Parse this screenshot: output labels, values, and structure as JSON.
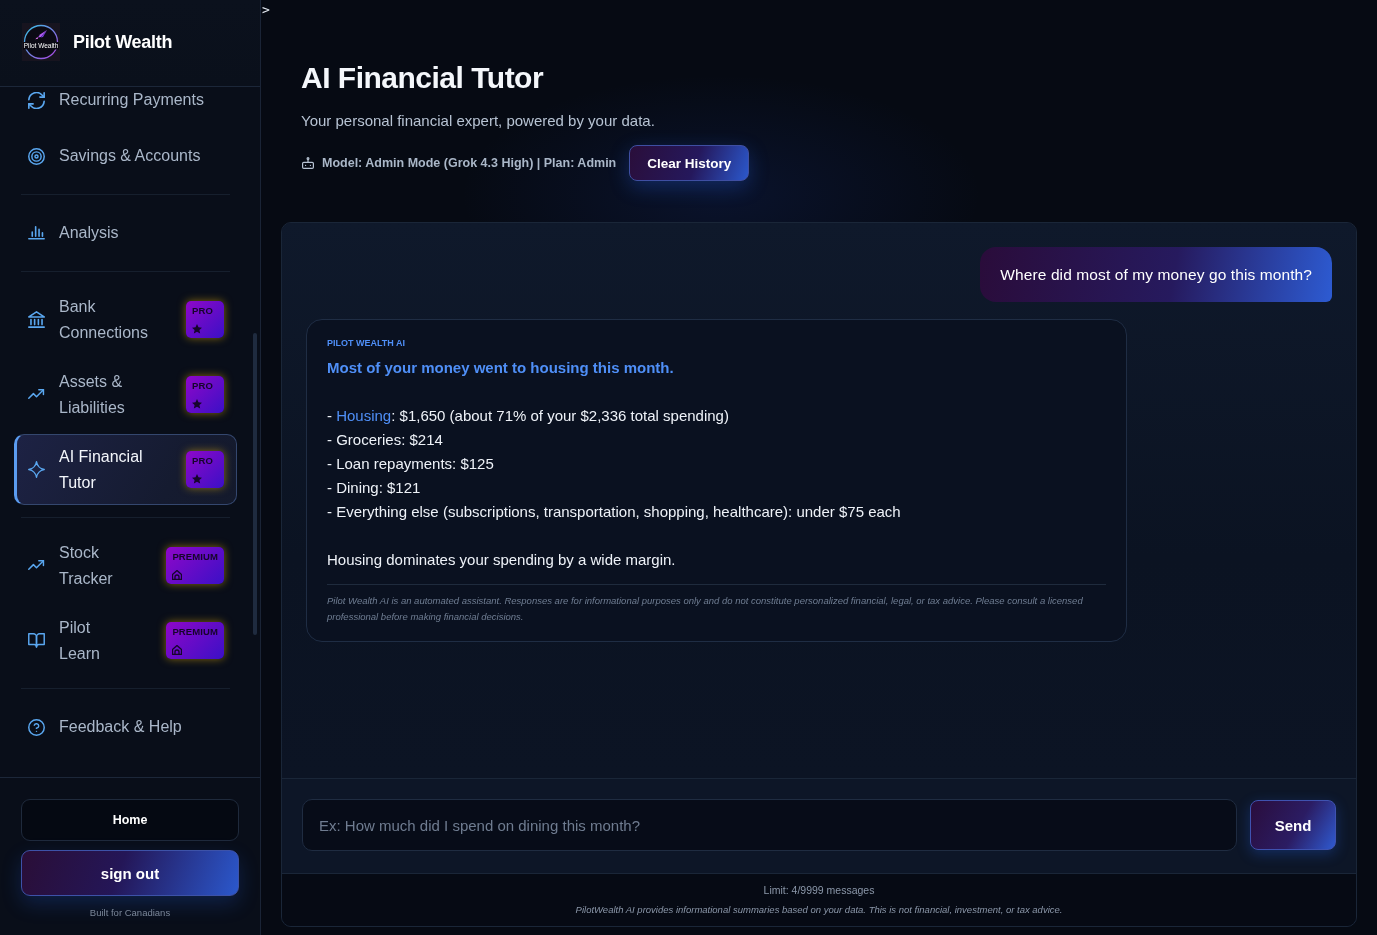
{
  "sidebar": {
    "brand": {
      "logo_text": "Pilot Wealth",
      "name": "Pilot Wealth"
    },
    "nav_groups": [
      {
        "items": [
          {
            "label": "Recurring Payments",
            "selected": false
          },
          {
            "label": "Savings & Accounts",
            "selected": false
          }
        ]
      },
      {
        "items": [
          {
            "label": "Analysis",
            "selected": false
          }
        ]
      },
      {
        "items": [
          {
            "label": "Bank Connections",
            "selected": false,
            "badge": {
              "kind": "pro",
              "text": "PRO"
            }
          },
          {
            "label": "Assets & Liabilities",
            "selected": false,
            "badge": {
              "kind": "pro",
              "text": "PRO"
            }
          },
          {
            "label": "AI Financial Tutor",
            "selected": true,
            "badge": {
              "kind": "pro",
              "text": "PRO"
            }
          }
        ]
      },
      {
        "items": [
          {
            "label": "Stock Tracker",
            "selected": false,
            "badge": {
              "kind": "premium",
              "text": "PREMIUM"
            }
          },
          {
            "label": "Pilot Learn",
            "selected": false,
            "badge": {
              "kind": "premium",
              "text": "PREMIUM"
            }
          }
        ]
      },
      {
        "items": [
          {
            "label": "Feedback & Help",
            "selected": false
          }
        ]
      }
    ],
    "footer": {
      "home_button": "Home",
      "sign_out_button": "sign out",
      "tagline": "Built for Canadians"
    }
  },
  "main": {
    "sidebar_toggle": ">",
    "title": "AI Financial Tutor",
    "subtitle": "Your personal financial expert, powered by your data.",
    "model_info": "Model: Admin Mode (Grok 4.3 High) | Plan: Admin",
    "clear_history_button": "Clear History"
  },
  "chat": {
    "messages": [
      {
        "kind": "user",
        "text": "Where did most of my money go this month?"
      },
      {
        "kind": "assistant",
        "sender": "PILOT WEALTH AI",
        "headline": "Most of your money went to housing this month.",
        "lines": [
          "- **Housing**: $1,650 (about 71% of your $2,336 total spending)",
          "- Groceries: $214",
          "- Loan repayments: $125",
          "- Dining: $121",
          "- Everything else (subscriptions, transportation, shopping, healthcare): under $75 each"
        ],
        "closing": "Housing dominates your spending by a wide margin.",
        "disclaimer": "Pilot Wealth AI is an automated assistant. Responses are for informational purposes only and do not constitute personalized financial, legal, or tax advice. Please consult a licensed professional before making financial decisions."
      }
    ],
    "input": {
      "placeholder": "Ex: How much did I spend on dining this month?"
    },
    "send_button": "Send",
    "limit": "Limit: 4/9999 messages",
    "disclaimer": "PilotWealth AI provides informational summaries based on your data. This is not financial, investment, or tax advice."
  }
}
